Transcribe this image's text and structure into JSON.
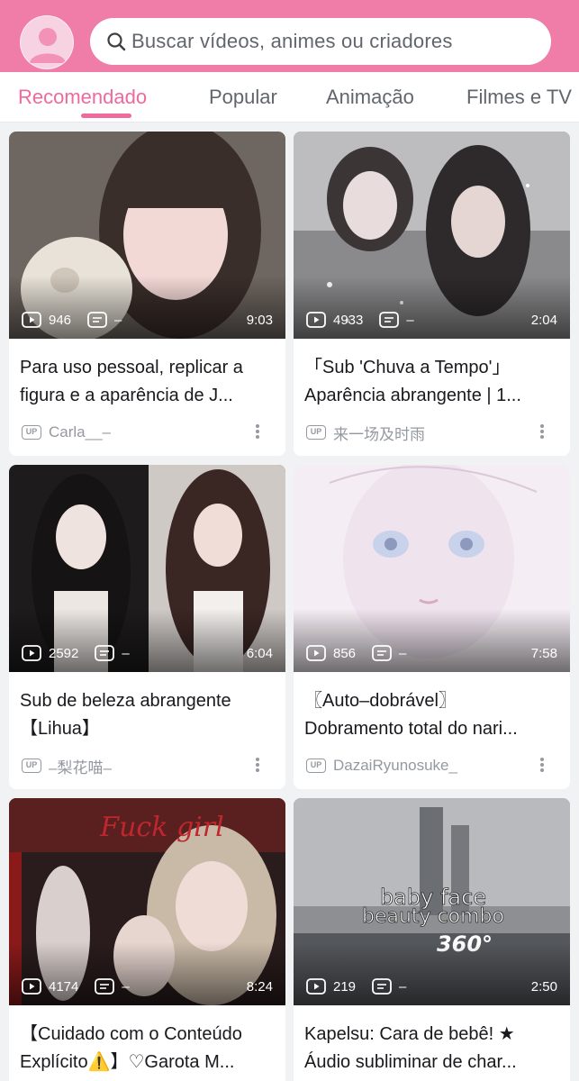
{
  "header": {
    "avatar_icon": "user-avatar-icon",
    "search": {
      "placeholder": "Buscar vídeos, animes ou criadores",
      "icon": "search-icon"
    }
  },
  "tabs": [
    {
      "label": "Recomendado",
      "active": true
    },
    {
      "label": "Popular",
      "active": false
    },
    {
      "label": "Animação",
      "active": false
    },
    {
      "label": "Filmes e TV",
      "active": false
    }
  ],
  "colors": {
    "brand": "#f07ca8",
    "accent": "#ee6a9c",
    "muted": "#9499a0"
  },
  "videos": [
    {
      "views": "946",
      "danmaku": "–",
      "duration": "9:03",
      "title_line1": "Para uso pessoal, replicar a",
      "title_line2": "figura e a aparência de J...",
      "author": "Carla__–"
    },
    {
      "views": "4933",
      "danmaku": "–",
      "duration": "2:04",
      "title_line1": "「Sub 'Chuva a Tempo'」",
      "title_line2": "Aparência abrangente | 1...",
      "author": "来一场及时雨"
    },
    {
      "views": "2592",
      "danmaku": "–",
      "duration": "6:04",
      "title_line1": "Sub de beleza abrangente",
      "title_line2": "【Lihua】",
      "author": "–梨花喵–"
    },
    {
      "views": "856",
      "danmaku": "–",
      "duration": "7:58",
      "title_line1": "〖Auto–dobrável〗",
      "title_line2": "Dobramento total do nari...",
      "author": "DazaiRyunosuke_"
    },
    {
      "views": "4174",
      "danmaku": "–",
      "duration": "8:24",
      "title_line1": "【Cuidado com o Conteúdo",
      "title_line2": "Explícito⚠️】♡Garota M...",
      "author": "",
      "thumb_text": "Fuck girl"
    },
    {
      "views": "219",
      "danmaku": "–",
      "duration": "2:50",
      "title_line1": "Kapelsu: Cara de bebê! ★",
      "title_line2": "Áudio subliminar de char...",
      "author": "",
      "thumb_text_1": "baby face",
      "thumb_text_2": "beauty combo",
      "thumb_text_3": "360°"
    }
  ]
}
